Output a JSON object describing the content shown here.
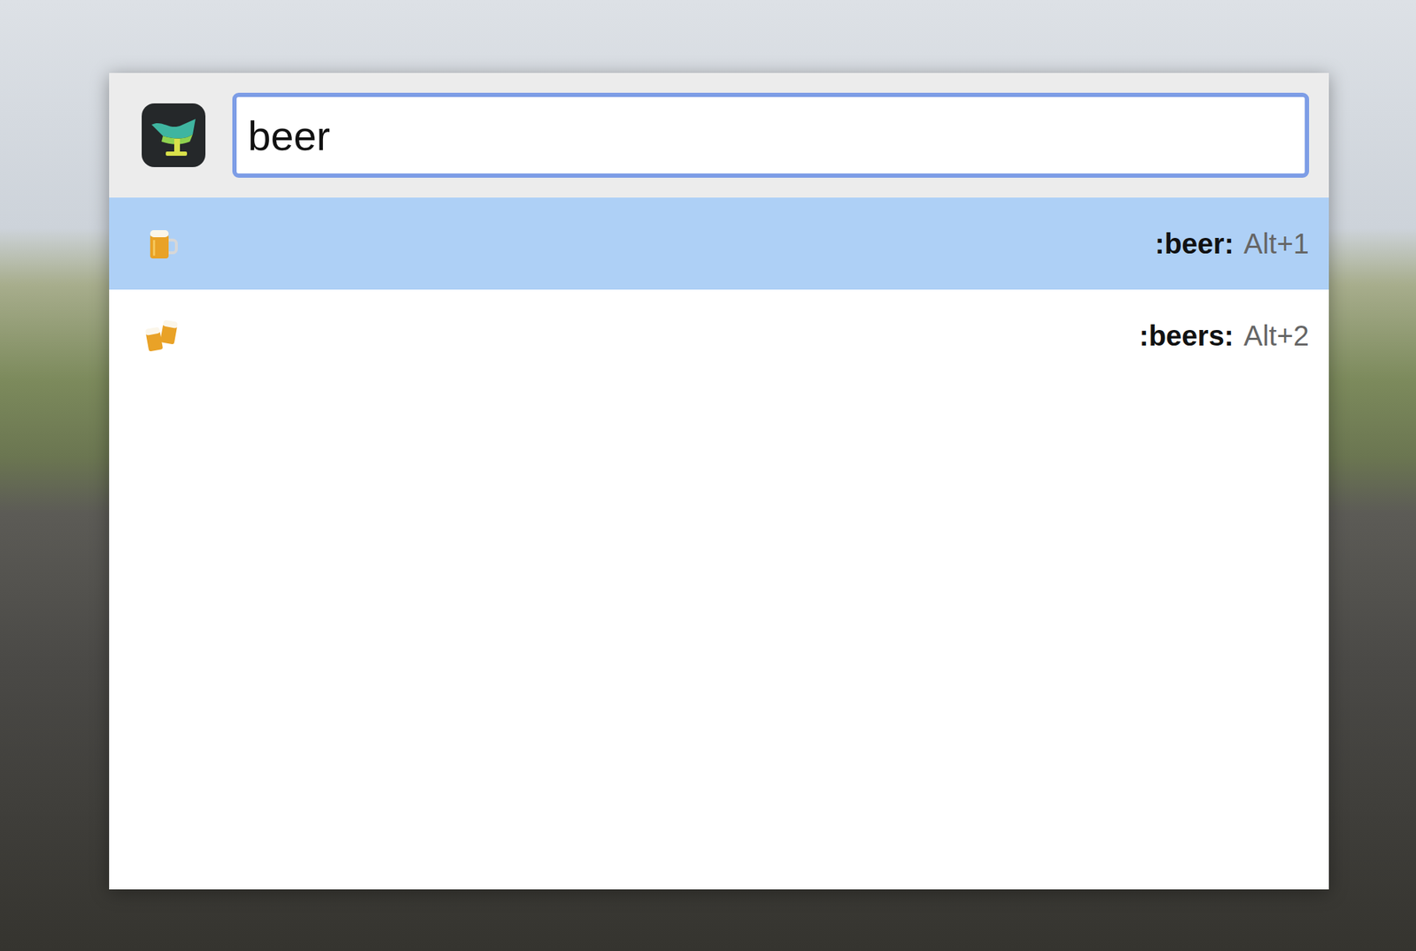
{
  "launcher": {
    "query": "beer"
  },
  "results": [
    {
      "name": ":beer:",
      "shortcut": "Alt+1",
      "selected": true,
      "kind": "mug"
    },
    {
      "name": ":beers:",
      "shortcut": "Alt+2",
      "selected": false,
      "kind": "mugs"
    }
  ]
}
